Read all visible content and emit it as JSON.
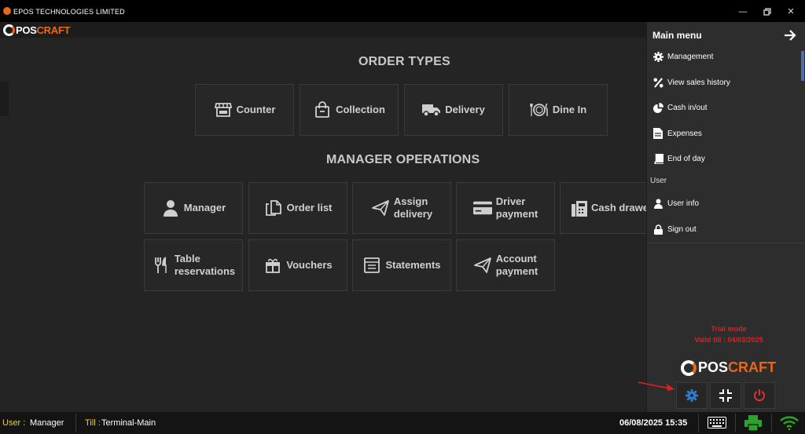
{
  "window": {
    "title": "EPOS TECHNOLOGIES LIMITED",
    "controls": [
      "minimize-icon",
      "restore-icon",
      "close-icon"
    ]
  },
  "brand": {
    "logo_primary": "POS",
    "logo_accent": "CRAFT",
    "accent_color": "#e8681a"
  },
  "order_types": {
    "title": "ORDER TYPES",
    "items": [
      {
        "label": "Counter",
        "icon": "store-icon"
      },
      {
        "label": "Collection",
        "icon": "bag-icon"
      },
      {
        "label": "Delivery",
        "icon": "truck-icon"
      },
      {
        "label": "Dine In",
        "icon": "plate-icon"
      }
    ]
  },
  "manager_operations": {
    "title": "MANAGER OPERATIONS",
    "items": [
      {
        "label": "Manager",
        "icon": "person-icon"
      },
      {
        "label": "Order list",
        "icon": "copy-icon"
      },
      {
        "label": "Assign delivery",
        "line1": "Assign",
        "line2": "delivery",
        "icon": "send-icon"
      },
      {
        "label": "Driver payment",
        "line1": "Driver",
        "line2": "payment",
        "icon": "card-icon"
      },
      {
        "label": "Cash drawer",
        "icon": "fax-icon"
      },
      {
        "label": "Table reservations",
        "line1": "Table",
        "line2": "reservations",
        "icon": "utensils-icon"
      },
      {
        "label": "Vouchers",
        "icon": "gift-icon"
      },
      {
        "label": "Statements",
        "icon": "statement-icon"
      },
      {
        "label": "Account payment",
        "line1": "Account",
        "line2": "payment",
        "icon": "send-icon"
      }
    ]
  },
  "sidebar": {
    "title": "Main menu",
    "items": [
      {
        "label": "Management",
        "icon": "gear-icon"
      },
      {
        "label": "View sales history",
        "icon": "percent-icon"
      },
      {
        "label": "Cash in/out",
        "icon": "pie-chart-icon"
      },
      {
        "label": "Expenses",
        "icon": "document-icon"
      },
      {
        "label": "End of day",
        "icon": "book-icon"
      }
    ],
    "user_section": {
      "title": "User",
      "items": [
        {
          "label": "User info",
          "icon": "user-icon"
        },
        {
          "label": "Sign out",
          "icon": "lock-icon"
        }
      ]
    },
    "trial": {
      "line1": "Trial mode",
      "line2": "Valid till : 04/03/2025",
      "color": "#e02020"
    },
    "bottom_buttons": [
      "settings-gear-icon",
      "compress-icon",
      "power-icon"
    ]
  },
  "status_bar": {
    "user_label": "User :",
    "user_value": "Manager",
    "till_label": "Till :",
    "till_value": "Terminal-Main",
    "datetime": "06/08/2025 15:35",
    "label_color": "#f0d020",
    "printer_color": "#2aa52a",
    "wifi_color": "#2aa52a"
  }
}
